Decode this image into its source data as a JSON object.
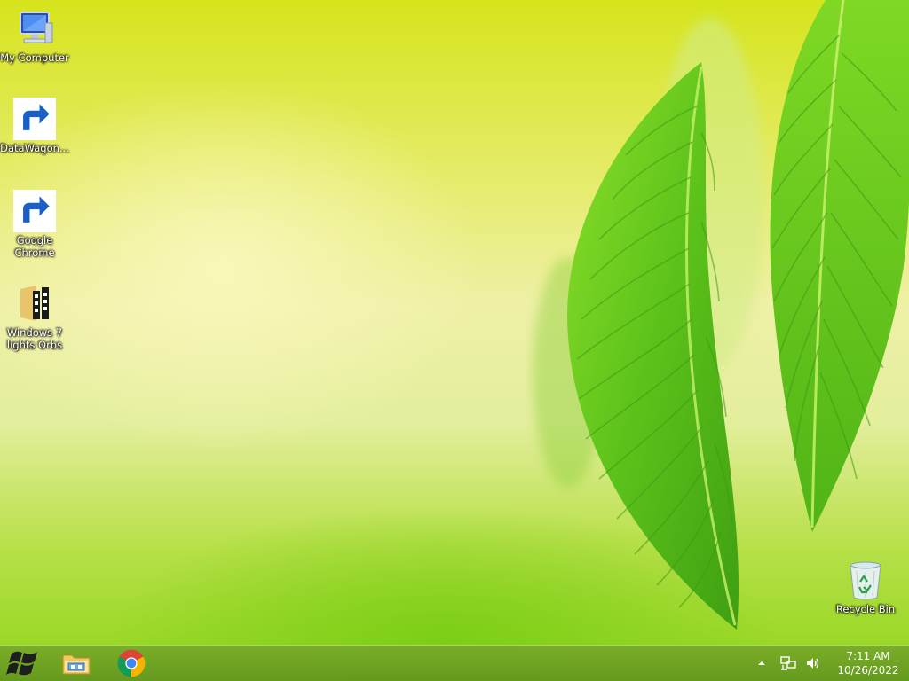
{
  "desktop": {
    "icons": [
      {
        "label": "My Computer",
        "icon": "computer-icon"
      },
      {
        "label": "DataWagon...",
        "icon": "datawagon-icon"
      },
      {
        "label": "Google Chrome",
        "icon": "chrome-icon"
      },
      {
        "label": "Windows 7 lights Orbs",
        "icon": "folder-icon"
      },
      {
        "label": "Recycle Bin",
        "icon": "recycle-bin-icon"
      }
    ]
  },
  "taskbar": {
    "start_icon": "windows-logo-icon",
    "pinned": [
      {
        "icon": "file-explorer-icon"
      },
      {
        "icon": "chrome-icon"
      }
    ],
    "tray": {
      "icons": [
        "show-hidden-icons-icon",
        "network-icon",
        "volume-icon"
      ],
      "time": "7:11 AM",
      "date": "10/26/2022"
    }
  },
  "colors": {
    "taskbar": "#6a9a24",
    "wallpaper_top": "#d6e41c",
    "wallpaper_bottom": "#8fd51a",
    "leaf": "#5cc21a"
  }
}
